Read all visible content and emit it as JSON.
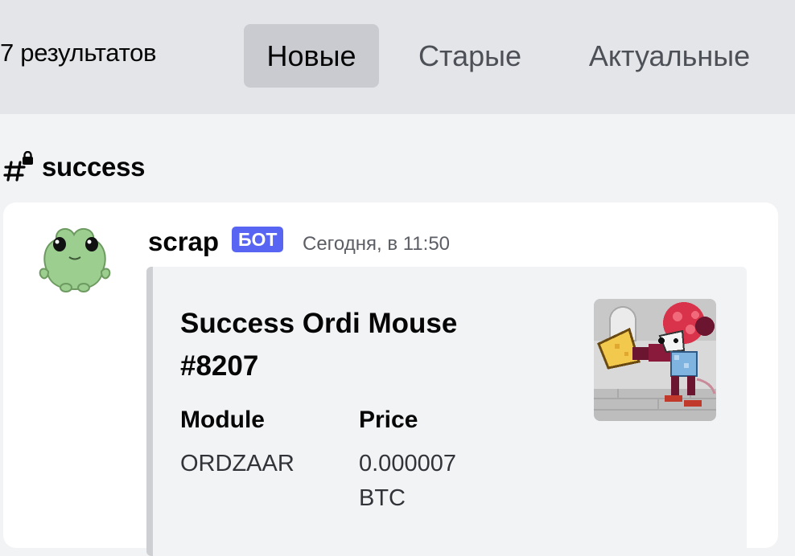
{
  "search": {
    "results_count": "7 результатов",
    "tabs": [
      {
        "label": "Новые",
        "active": true
      },
      {
        "label": "Старые",
        "active": false
      },
      {
        "label": "Актуальные",
        "active": false
      }
    ]
  },
  "channel": {
    "name": "success",
    "icon": "hash-lock-icon"
  },
  "message": {
    "author": "scrap",
    "badge": "БОТ",
    "timestamp": "Сегодня, в 11:50",
    "avatar": "frog-avatar",
    "embed": {
      "title": "Success Ordi Mouse #8207",
      "fields": [
        {
          "name": "Module",
          "value": "ORDZAAR"
        },
        {
          "name": "Price",
          "value": "0.000007 BTC"
        }
      ],
      "thumbnail": "pixel-mouse-nft-thumbnail"
    }
  },
  "colors": {
    "topbar_bg": "#e3e5e8",
    "page_bg": "#f2f3f5",
    "active_tab_bg": "#c9cbd0",
    "bot_badge": "#5865f2",
    "card_bg": "#ffffff",
    "embed_border": "#cdcfd3"
  }
}
